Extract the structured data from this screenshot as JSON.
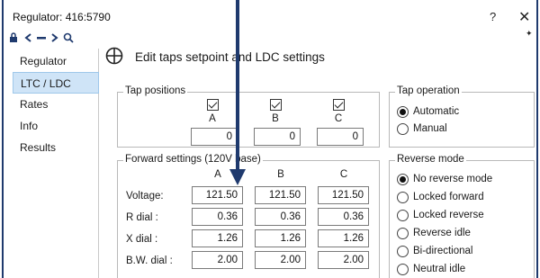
{
  "window": {
    "title": "Regulator: 416:5790",
    "help_label": "?",
    "close_label": "✕"
  },
  "toolbar": {
    "icons": [
      "lock-icon",
      "back-icon",
      "minus-icon",
      "forward-icon",
      "zoom-icon"
    ],
    "pin_glyph": "✦"
  },
  "sidebar": {
    "items": [
      {
        "label": "Regulator",
        "active": false
      },
      {
        "label": "LTC / LDC",
        "active": true
      },
      {
        "label": "Rates",
        "active": false
      },
      {
        "label": "Info",
        "active": false
      },
      {
        "label": "Results",
        "active": false
      }
    ]
  },
  "header": {
    "title": "Edit taps setpoint and LDC settings"
  },
  "tap_positions": {
    "title": "Tap positions",
    "columns": [
      "A",
      "B",
      "C"
    ],
    "values": [
      "0",
      "0",
      "0"
    ]
  },
  "tap_operation": {
    "title": "Tap operation",
    "options": [
      {
        "label": "Automatic",
        "selected": true
      },
      {
        "label": "Manual",
        "selected": false
      }
    ]
  },
  "forward_settings": {
    "title": "Forward settings (120V base)",
    "columns": [
      "A",
      "B",
      "C"
    ],
    "rows": [
      {
        "label": "Voltage:",
        "values": [
          "121.50",
          "121.50",
          "121.50"
        ]
      },
      {
        "label": "R dial :",
        "values": [
          "0.36",
          "0.36",
          "0.36"
        ]
      },
      {
        "label": "X dial :",
        "values": [
          "1.26",
          "1.26",
          "1.26"
        ]
      },
      {
        "label": "B.W. dial :",
        "values": [
          "2.00",
          "2.00",
          "2.00"
        ]
      }
    ]
  },
  "reverse_mode": {
    "title": "Reverse mode",
    "options": [
      {
        "label": "No reverse mode",
        "selected": true
      },
      {
        "label": "Locked forward",
        "selected": false
      },
      {
        "label": "Locked reverse",
        "selected": false
      },
      {
        "label": "Reverse idle",
        "selected": false
      },
      {
        "label": "Bi-directional",
        "selected": false
      },
      {
        "label": "Neutral idle",
        "selected": false
      }
    ]
  },
  "colors": {
    "frame": "#1f3a6e",
    "selected_nav": "#cfe4f7",
    "annotation_arrow": "#1f3a6e"
  }
}
